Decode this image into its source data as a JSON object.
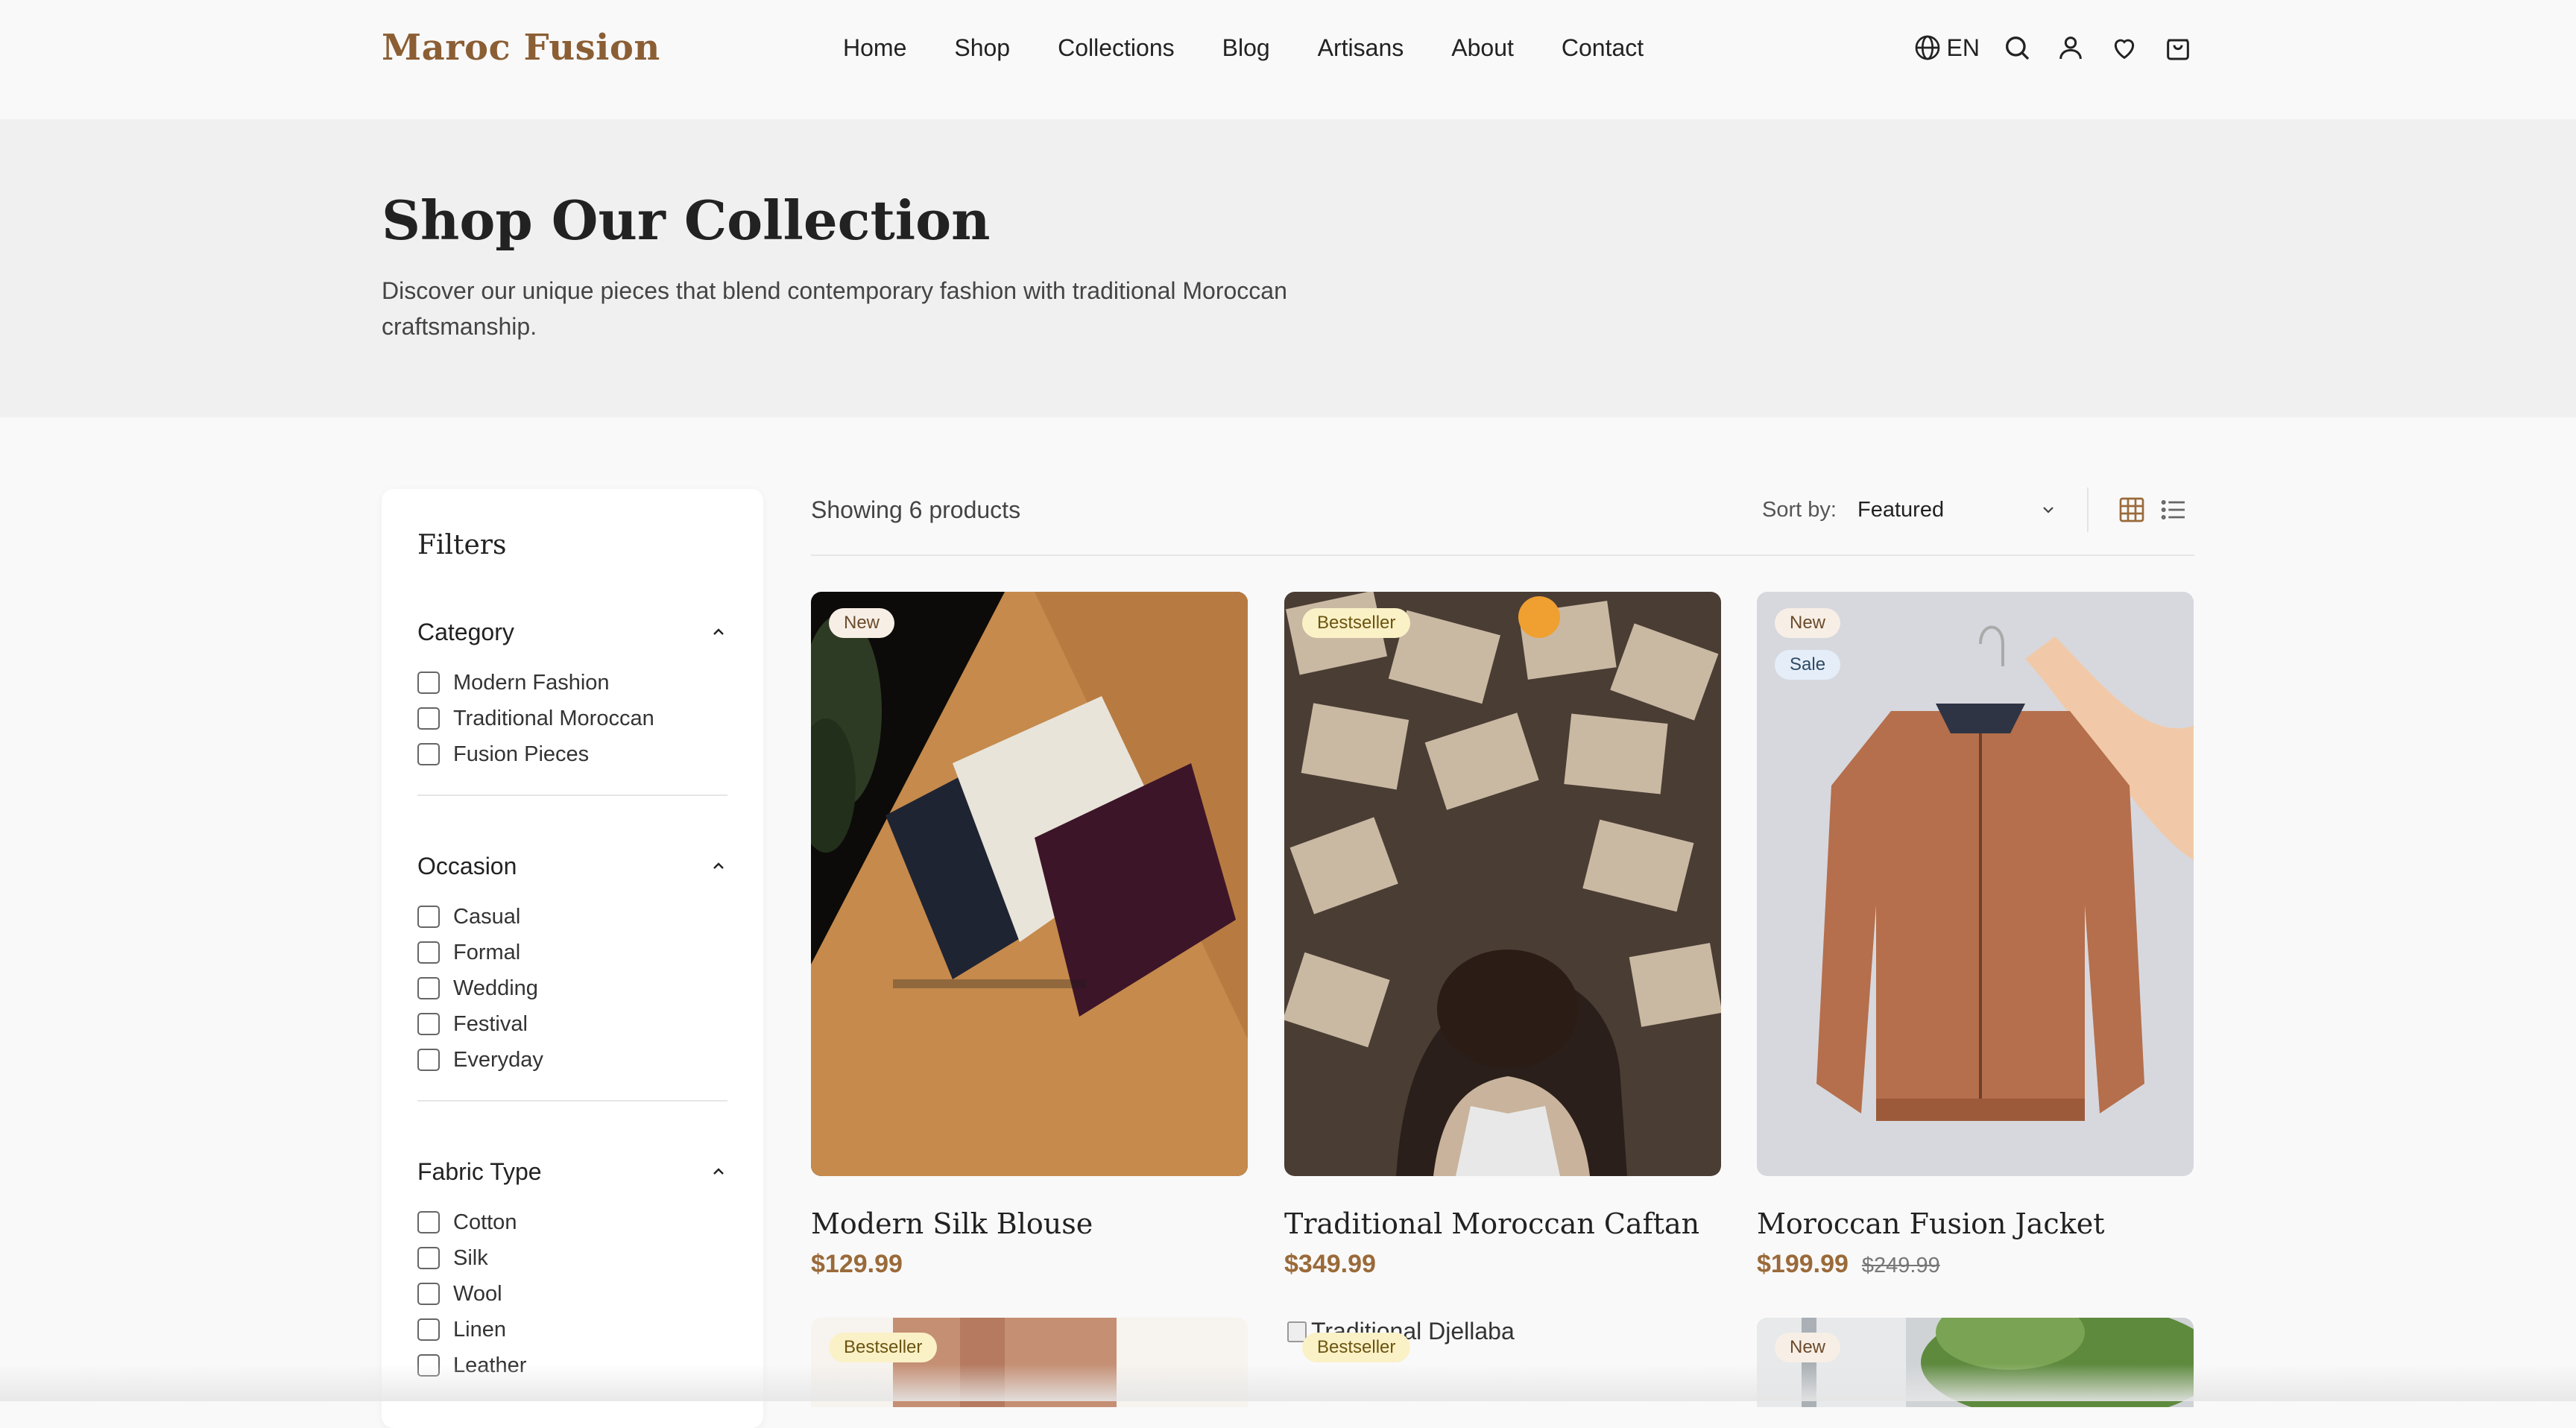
{
  "header": {
    "brand": "Maroc Fusion",
    "nav": [
      "Home",
      "Shop",
      "Collections",
      "Blog",
      "Artisans",
      "About",
      "Contact"
    ],
    "language": "EN",
    "icons": [
      "globe-icon",
      "search-icon",
      "user-icon",
      "heart-icon",
      "bag-icon"
    ]
  },
  "hero": {
    "title": "Shop Our Collection",
    "subtitle": "Discover our unique pieces that blend contemporary fashion with traditional Moroccan craftsmanship."
  },
  "filters": {
    "title": "Filters",
    "groups": [
      {
        "label": "Category",
        "options": [
          "Modern Fashion",
          "Traditional Moroccan",
          "Fusion Pieces"
        ]
      },
      {
        "label": "Occasion",
        "options": [
          "Casual",
          "Formal",
          "Wedding",
          "Festival",
          "Everyday"
        ]
      },
      {
        "label": "Fabric Type",
        "options": [
          "Cotton",
          "Silk",
          "Wool",
          "Linen",
          "Leather"
        ]
      }
    ]
  },
  "toolbar": {
    "count": "Showing 6 products",
    "sort_label": "Sort by:",
    "sort_value": "Featured",
    "views": [
      "grid-view-icon",
      "list-view-icon"
    ]
  },
  "products": [
    {
      "name": "Modern Silk Blouse",
      "price": "$129.99",
      "old_price": "",
      "badges": [
        "New"
      ]
    },
    {
      "name": "Traditional Moroccan Caftan",
      "price": "$349.99",
      "old_price": "",
      "badges": [
        "Bestseller"
      ]
    },
    {
      "name": "Moroccan Fusion Jacket",
      "price": "$199.99",
      "old_price": "$249.99",
      "badges": [
        "New",
        "Sale"
      ]
    }
  ],
  "second_row": [
    {
      "badges": [
        "Bestseller"
      ],
      "alt": ""
    },
    {
      "badges": [
        "Bestseller"
      ],
      "alt": "Traditional Djellaba"
    },
    {
      "badges": [
        "New"
      ],
      "alt": ""
    }
  ],
  "colors": {
    "brand": "#8b5e34",
    "price": "#9a6a3a",
    "hero_bg": "#f0f0f0"
  }
}
